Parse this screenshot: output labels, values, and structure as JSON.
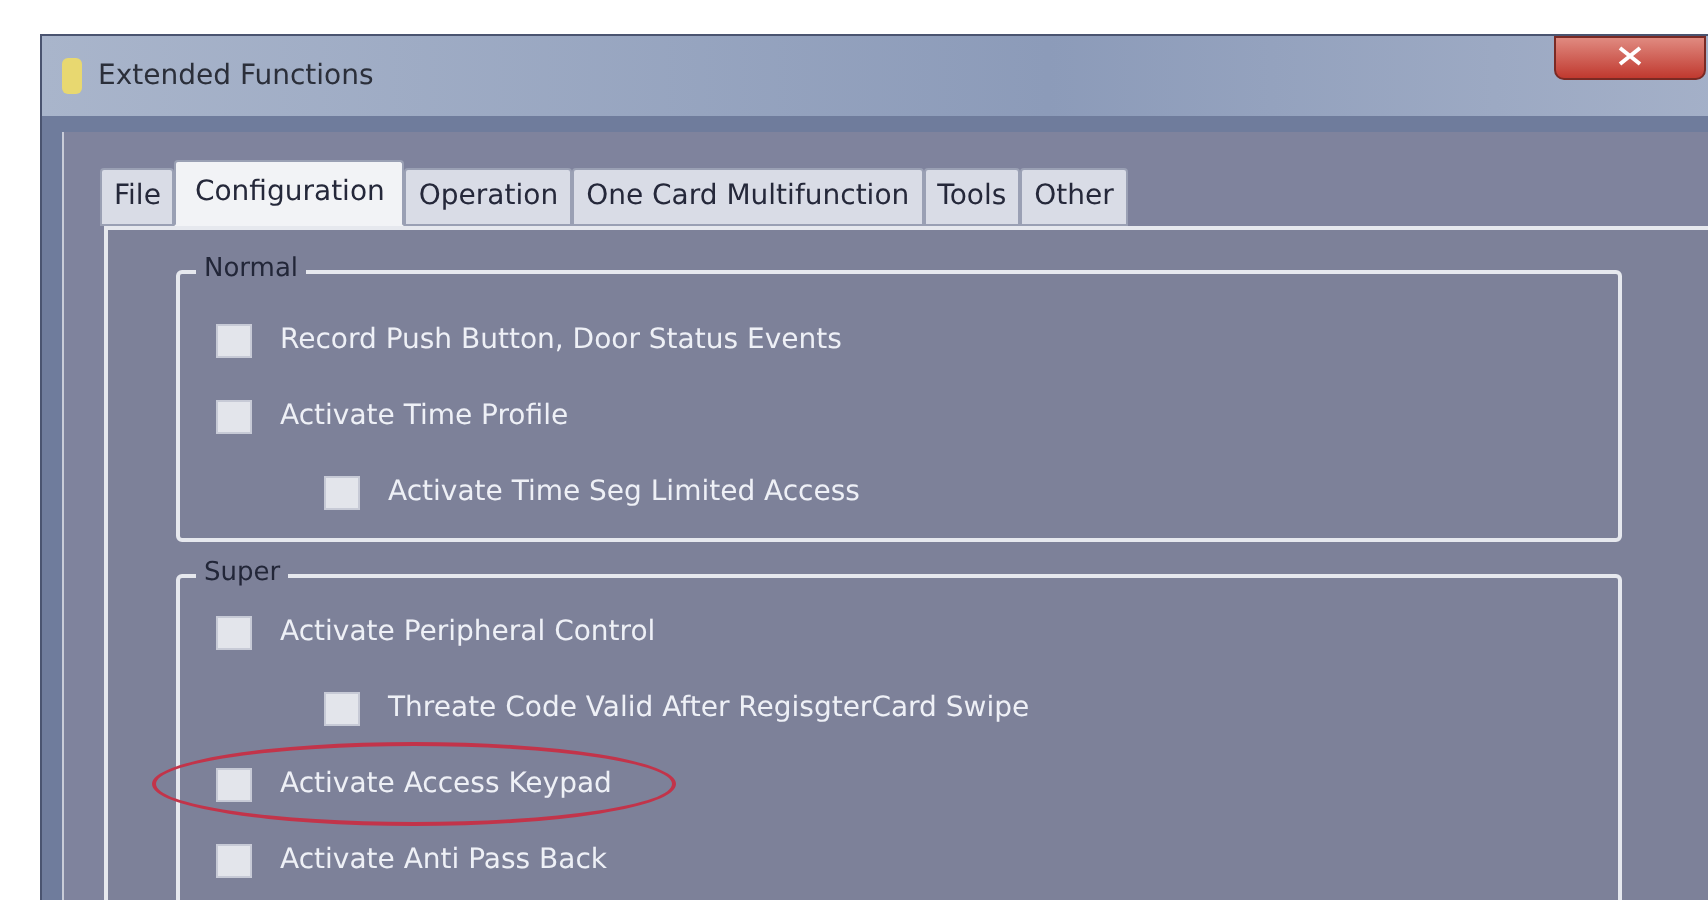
{
  "window": {
    "title": "Extended Functions"
  },
  "tabs": [
    {
      "label": "File",
      "selected": false
    },
    {
      "label": "Configuration",
      "selected": true
    },
    {
      "label": "Operation",
      "selected": false
    },
    {
      "label": "One Card Multifunction",
      "selected": false
    },
    {
      "label": "Tools",
      "selected": false
    },
    {
      "label": "Other",
      "selected": false
    }
  ],
  "groups": [
    {
      "title": "Normal",
      "options": [
        {
          "label": "Record Push Button, Door Status Events",
          "checked": false,
          "circled": false
        },
        {
          "label": "Activate Time Profile",
          "checked": false,
          "circled": false,
          "children": [
            {
              "label": "Activate Time Seg Limited Access",
              "checked": false,
              "circled": false
            }
          ]
        }
      ]
    },
    {
      "title": "Super",
      "options": [
        {
          "label": "Activate Peripheral Control",
          "checked": false,
          "circled": false,
          "children": [
            {
              "label": "Threate Code Valid After RegisgterCard Swipe",
              "checked": false,
              "circled": false
            }
          ]
        },
        {
          "label": "Activate Access Keypad",
          "checked": false,
          "circled": true
        },
        {
          "label": "Activate Anti Pass Back",
          "checked": false,
          "circled": false
        }
      ]
    }
  ]
}
